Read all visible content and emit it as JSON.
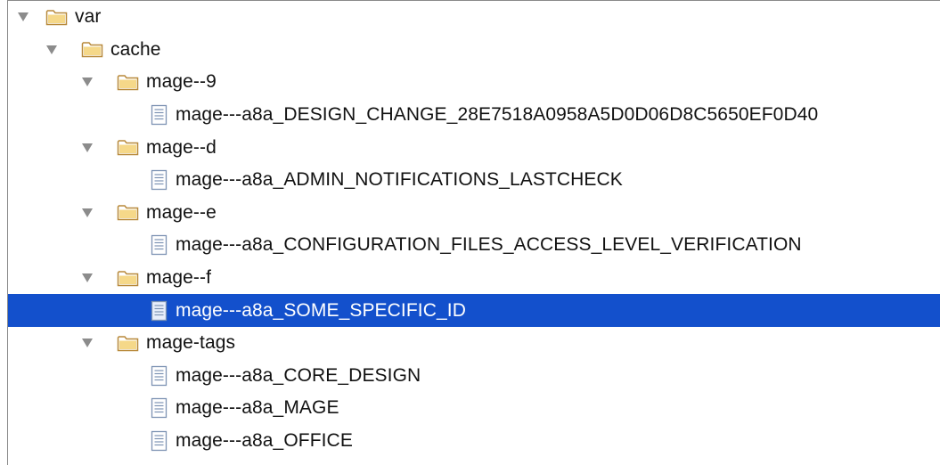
{
  "tree": {
    "rows": [
      {
        "label": "var",
        "type": "folder",
        "expanded": true,
        "depth": 0
      },
      {
        "label": "cache",
        "type": "folder",
        "expanded": true,
        "depth": 1
      },
      {
        "label": "mage--9",
        "type": "folder",
        "expanded": true,
        "depth": 2
      },
      {
        "label": "mage---a8a_DESIGN_CHANGE_28E7518A0958A5D0D06D8C5650EF0D40",
        "type": "file",
        "depth": 3
      },
      {
        "label": "mage--d",
        "type": "folder",
        "expanded": true,
        "depth": 2
      },
      {
        "label": "mage---a8a_ADMIN_NOTIFICATIONS_LASTCHECK",
        "type": "file",
        "depth": 3
      },
      {
        "label": "mage--e",
        "type": "folder",
        "expanded": true,
        "depth": 2
      },
      {
        "label": "mage---a8a_CONFIGURATION_FILES_ACCESS_LEVEL_VERIFICATION",
        "type": "file",
        "depth": 3
      },
      {
        "label": "mage--f",
        "type": "folder",
        "expanded": true,
        "depth": 2
      },
      {
        "label": "mage---a8a_SOME_SPECIFIC_ID",
        "type": "file",
        "depth": 3,
        "selected": true
      },
      {
        "label": "mage-tags",
        "type": "folder",
        "expanded": true,
        "depth": 2
      },
      {
        "label": "mage---a8a_CORE_DESIGN",
        "type": "file",
        "depth": 3
      },
      {
        "label": "mage---a8a_MAGE",
        "type": "file",
        "depth": 3
      },
      {
        "label": "mage---a8a_OFFICE",
        "type": "file",
        "depth": 3
      }
    ]
  },
  "colors": {
    "selection": "#1350cc",
    "folder_fill": "#f5d889",
    "folder_stroke": "#b8893a",
    "arrow": "#8c8c8c",
    "file_stroke": "#7d93b3"
  },
  "icons": {
    "expand": "triangle-down-icon",
    "folder": "folder-icon",
    "file": "file-icon"
  }
}
